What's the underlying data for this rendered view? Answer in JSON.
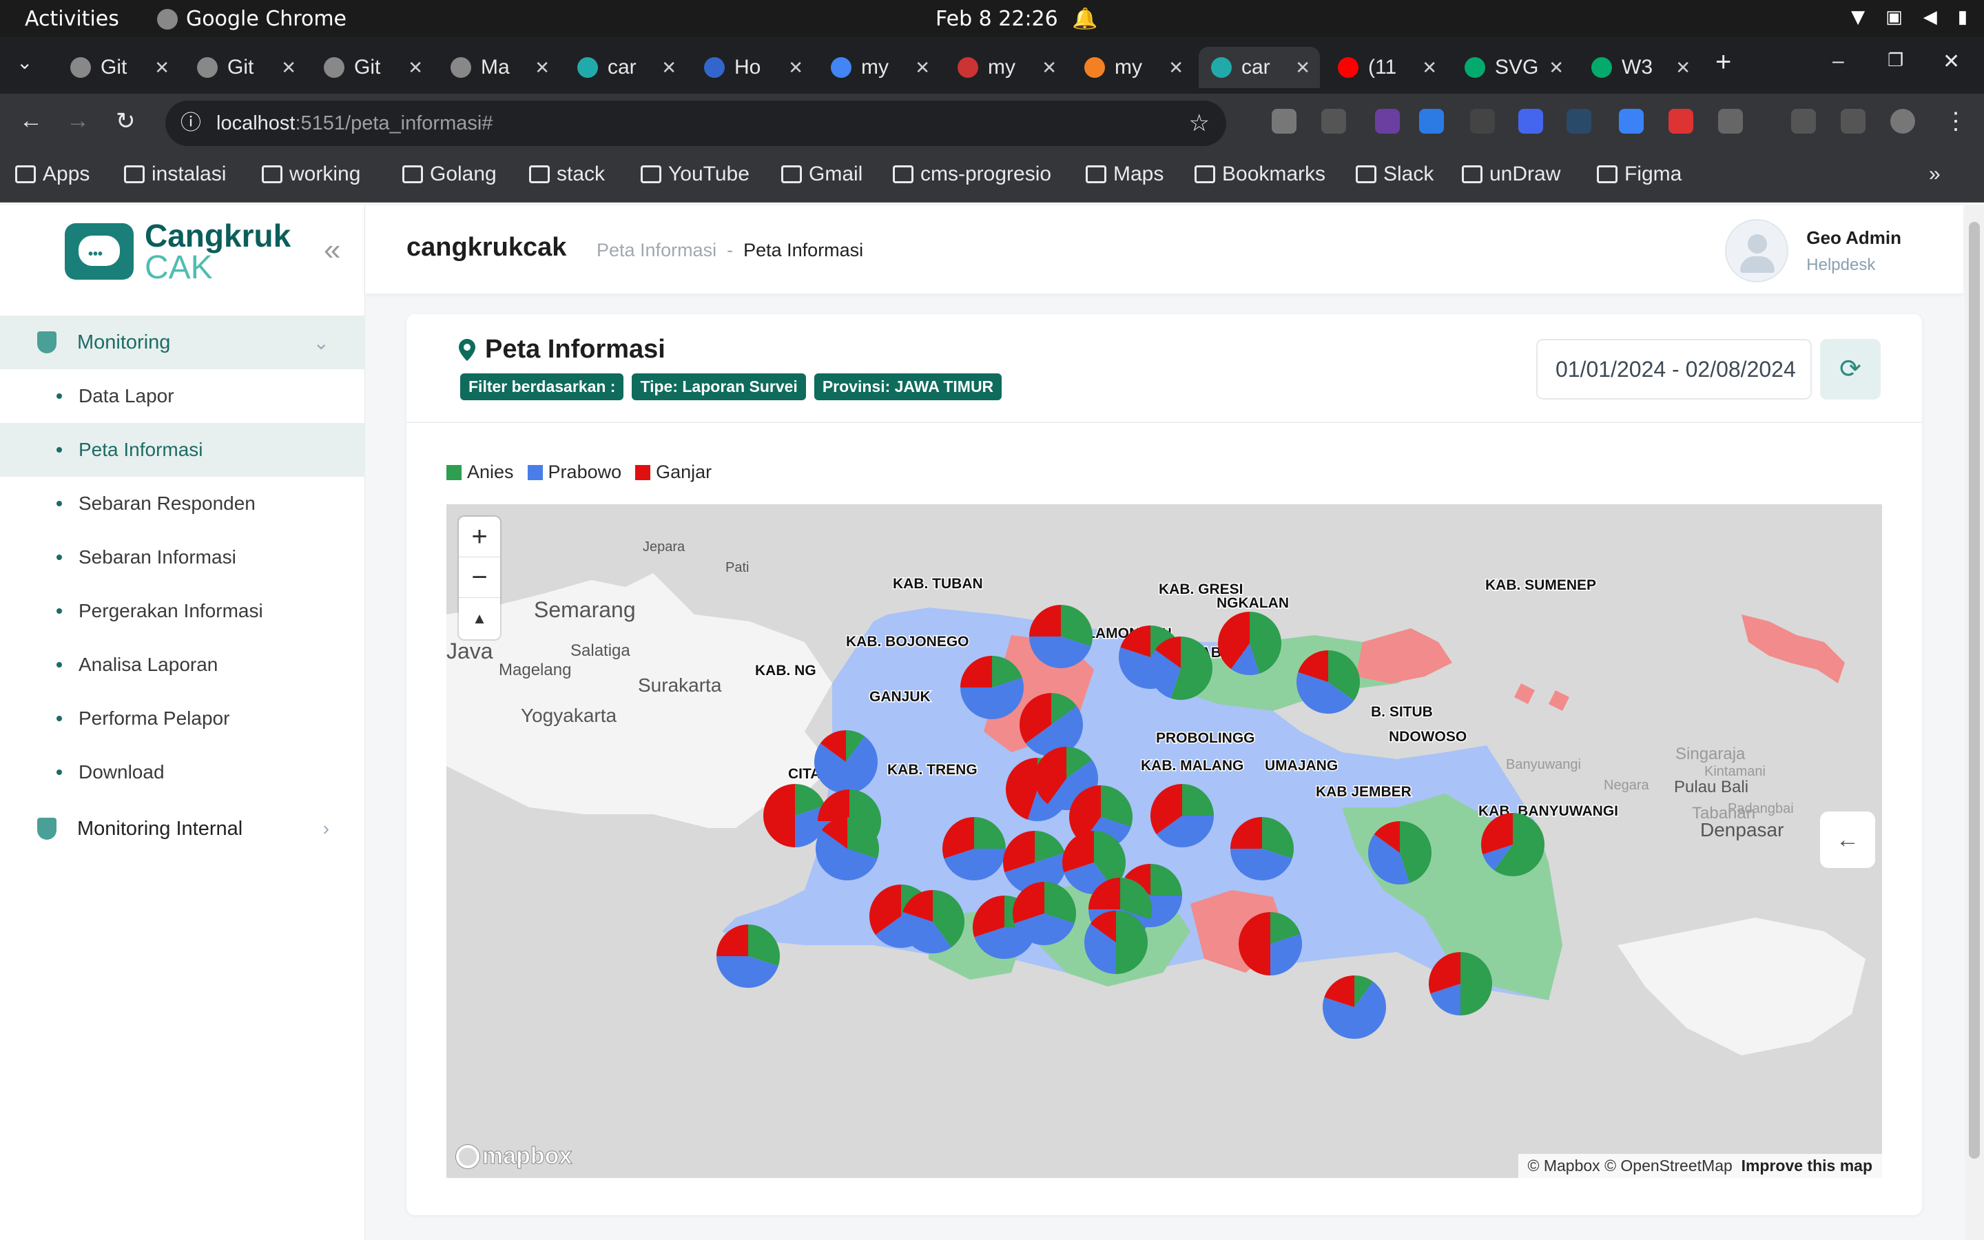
{
  "os": {
    "activities": "Activities",
    "app": "Google Chrome",
    "clock": "Feb 8  22:26"
  },
  "tabs": [
    {
      "label": "Git",
      "color": "#888"
    },
    {
      "label": "Git",
      "color": "#888"
    },
    {
      "label": "Git",
      "color": "#888"
    },
    {
      "label": "Ma",
      "color": "#888"
    },
    {
      "label": "car",
      "color": "#2aa"
    },
    {
      "label": "Ho",
      "color": "#3366cc"
    },
    {
      "label": "my",
      "color": "#4285f4"
    },
    {
      "label": "my",
      "color": "#c33"
    },
    {
      "label": "my",
      "color": "#f48024"
    },
    {
      "label": "car",
      "color": "#2aa"
    },
    {
      "label": "(11",
      "color": "#ff0000"
    },
    {
      "label": "SVG",
      "color": "#04aa6d"
    },
    {
      "label": "W3",
      "color": "#04aa6d"
    }
  ],
  "new_tab": "+",
  "address": {
    "host": "localhost",
    "path": ":5151/peta_informasi#"
  },
  "bookmarks": [
    "Apps",
    "instalasi",
    "working",
    "Golang",
    "stack",
    "YouTube",
    "Gmail",
    "cms-progresio",
    "Maps",
    "Bookmarks",
    "Slack",
    "unDraw",
    "Figma"
  ],
  "sidebar": {
    "logo_line1": "Cangkruk",
    "logo_line2": "CAK",
    "section1": "Monitoring",
    "items": [
      "Data Lapor",
      "Peta Informasi",
      "Sebaran Responden",
      "Sebaran Informasi",
      "Pergerakan Informasi",
      "Analisa Laporan",
      "Performa Pelapor",
      "Download"
    ],
    "section2": "Monitoring Internal"
  },
  "header": {
    "brand": "cangkrukcak",
    "crumb_parent": "Peta Informasi",
    "crumb_sep": "-",
    "crumb_current": "Peta Informasi",
    "user_name": "Geo Admin",
    "user_role": "Helpdesk"
  },
  "card": {
    "title": "Peta Informasi",
    "badges": [
      "Filter berdasarkan :",
      "Tipe: Laporan Survei",
      "Provinsi: JAWA TIMUR"
    ],
    "date_range": "01/01/2024 - 02/08/2024"
  },
  "legend": [
    {
      "label": "Anies",
      "color": "#2e9e4f"
    },
    {
      "label": "Prabowo",
      "color": "#4a7de8"
    },
    {
      "label": "Ganjar",
      "color": "#e01010"
    }
  ],
  "map": {
    "zoom_in": "+",
    "zoom_out": "−",
    "compass": "▲",
    "attribution": "© Mapbox © OpenStreetMap",
    "improve": "Improve this map",
    "mapbox": "mapbox",
    "place_labels": [
      "Jepara",
      "Pati",
      "Semarang",
      "Java",
      "Salatiga",
      "Magelang",
      "Surakarta",
      "Yogyakarta",
      "Singaraja",
      "Kintamani",
      "Negara",
      "Pulau Bali",
      "Tabanan",
      "Padangbai",
      "Denpasar",
      "Banyuwangi"
    ],
    "region_labels": [
      "KAB. TUBAN",
      "KAB. GRESI",
      "KAB. SUMENEP",
      "KAB. LAMONGAN",
      "KAB. BOJONEGO",
      "A SURABAYA",
      "KAB. NG",
      "GANJUK",
      "KAB.",
      "PROBOLINGG",
      "B. SITUB",
      "NDOWOSO",
      "KAB. MALANG",
      "UMAJANG",
      "KAB JEMBER",
      "KAB. BANYUWANGI",
      "CITAN",
      "KAB. TRENG",
      "NGKALAN"
    ]
  }
}
